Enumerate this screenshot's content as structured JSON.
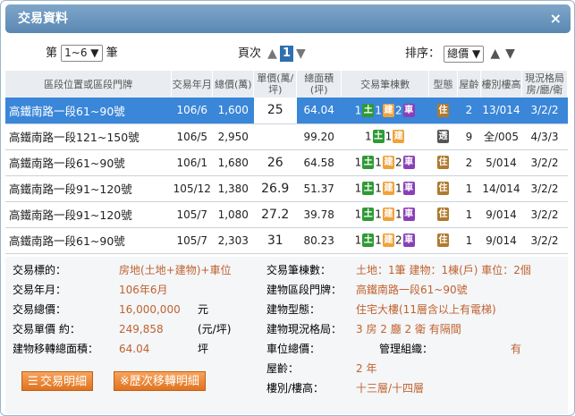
{
  "dialog": {
    "title": "交易資料",
    "close_label": "×"
  },
  "toolbar": {
    "item_prefix": "第",
    "item_range": "1~6 ▼",
    "item_suffix": "筆",
    "page_label": "頁次",
    "page_value": "1",
    "sort_label": "排序：",
    "sort_value": "總價 ▼"
  },
  "columns": [
    "區段位置或區段門牌",
    "交易年月",
    "總價(萬)",
    "單價(萬/坪)",
    "總面積(坪)",
    "交易筆棟數",
    "型態",
    "屋齡",
    "樓別樓高",
    "現況格局房/廳/衛"
  ],
  "rows": [
    {
      "addr": "高鐵南路一段61~90號",
      "date": "106/6",
      "total": "1,600",
      "unit": "25",
      "area": "64.04",
      "n1": "1",
      "n2": "1",
      "n3": "2",
      "type": "住",
      "age": "2",
      "floor": "13/014",
      "layout": "3/2/2"
    },
    {
      "addr": "高鐵南路一段121~150號",
      "date": "106/5",
      "total": "2,950",
      "unit": "",
      "area": "99.20",
      "n1": "1",
      "n2": "1",
      "n3": "",
      "type": "透",
      "age": "9",
      "floor": "全/005",
      "layout": "4/3/3"
    },
    {
      "addr": "高鐵南路一段61~90號",
      "date": "106/1",
      "total": "1,680",
      "unit": "26",
      "area": "64.58",
      "n1": "1",
      "n2": "1",
      "n3": "2",
      "type": "住",
      "age": "2",
      "floor": "5/014",
      "layout": "3/2/2"
    },
    {
      "addr": "高鐵南路一段91~120號",
      "date": "105/12",
      "total": "1,380",
      "unit": "26.9",
      "area": "51.37",
      "n1": "1",
      "n2": "1",
      "n3": "1",
      "type": "住",
      "age": "1",
      "floor": "14/014",
      "layout": "3/2/2"
    },
    {
      "addr": "高鐵南路一段91~120號",
      "date": "105/7",
      "total": "1,080",
      "unit": "27.2",
      "area": "39.78",
      "n1": "1",
      "n2": "1",
      "n3": "1",
      "type": "住",
      "age": "1",
      "floor": "9/014",
      "layout": "3/2/2"
    },
    {
      "addr": "高鐵南路一段61~90號",
      "date": "105/7",
      "total": "2,303",
      "unit": "31",
      "area": "80.23",
      "n1": "1",
      "n2": "1",
      "n3": "2",
      "type": "住",
      "age": "1",
      "floor": "9/014",
      "layout": "3/2/2"
    }
  ],
  "tags": {
    "land": "土",
    "building": "建",
    "car": "車"
  },
  "details": {
    "target_label": "交易標的：",
    "target_value": "房地(土地+建物)+車位",
    "date_label": "交易年月：",
    "date_value": "106年6月",
    "total_label": "交易總價：",
    "total_value": "16,000,000",
    "total_unit": "元",
    "unit_label": "交易單價 約：",
    "unit_value": "249,858",
    "unit_unit": "(元/坪)",
    "area_label": "建物移轉總面積：",
    "area_value": "64.04",
    "area_unit": "坪",
    "count_label": "交易筆棟數：",
    "count_value": "土地：1筆 建物：1棟(戶) 車位：2個",
    "addr_label": "建物區段門牌：",
    "addr_value": "高鐵南路一段61~90號",
    "btype_label": "建物型態：",
    "btype_value": "住宅大樓(11層含以上有電梯)",
    "layout_label": "建物現況格局：",
    "layout_value": "3 房 2 廳 2 衛 有隔間",
    "parking_label": "車位總價：",
    "mgmt_label": "管理組織：",
    "mgmt_value": "有",
    "age_label": "屋齡：",
    "age_value": "2 年",
    "floor_label": "樓別/樓高：",
    "floor_value": "十三層/十四層"
  },
  "buttons": {
    "detail": "交易明細",
    "history": "※歷次移轉明細"
  },
  "colors": {
    "title_bar": "#5a88b3",
    "selected_row": "#3a86d8",
    "land_tag": "#2f9a35",
    "building_tag": "#f0a23b",
    "car_tag": "#8a3fb8",
    "button": "#e0731f"
  }
}
